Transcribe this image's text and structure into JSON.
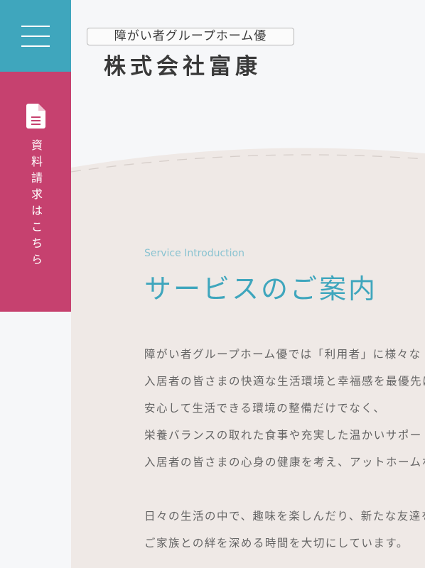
{
  "header": {
    "menu_label": "menu",
    "logo_tagline": "障がい者グループホーム優",
    "company_prefix": "株式会社",
    "company_name": "富康",
    "brand_colors": {
      "teal": "#3fa6bd",
      "pink": "#c6416f"
    }
  },
  "sidebar": {
    "docs_icon": "document-icon",
    "docs_label": "資料請求はこちら"
  },
  "section": {
    "subtitle": "Service Introduction",
    "title": "サービスのご案内",
    "paragraph1": [
      "障がい者グループホーム優では「利用者」に様々な",
      "入居者の皆さまの快適な生活環境と幸福感を最優先に",
      "安心して生活できる環境の整備だけでなく、",
      "栄養バランスの取れた食事や充実した温かいサポート",
      "入居者の皆さまの心身の健康を考え、アットホームな"
    ],
    "paragraph2": [
      "日々の生活の中で、趣味を楽しんだり、新たな友達を",
      "ご家族との絆を深める時間を大切にしています。"
    ]
  }
}
